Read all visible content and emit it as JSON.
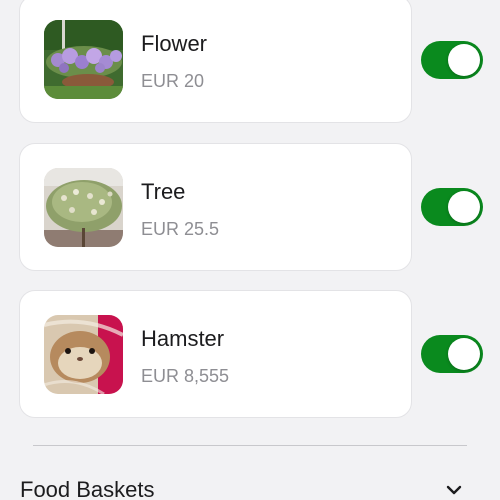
{
  "items": [
    {
      "name": "Flower",
      "price": "EUR 20",
      "enabled": true,
      "image": "flower-bush-photo"
    },
    {
      "name": "Tree",
      "price": "EUR 25.5",
      "enabled": true,
      "image": "flowering-shrub-photo"
    },
    {
      "name": "Hamster",
      "price": "EUR 8,555",
      "enabled": true,
      "image": "hamster-photo"
    }
  ],
  "section": {
    "title": "Food Baskets",
    "icon": "chevron-down-icon"
  },
  "colors": {
    "toggle_on": "#0a8a1e",
    "card_bg": "#ffffff",
    "page_bg": "#f2f2f4",
    "secondary_text": "#8e8e93"
  }
}
